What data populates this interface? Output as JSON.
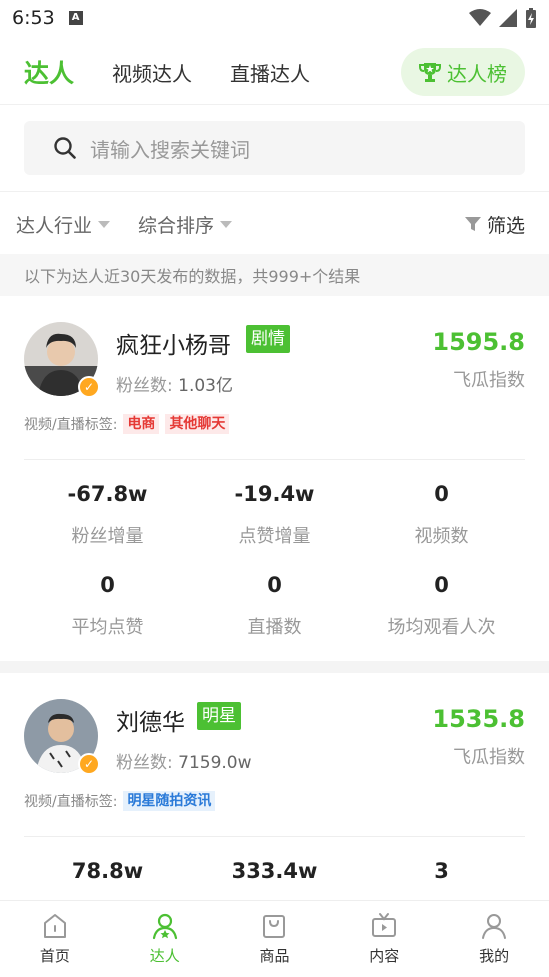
{
  "status": {
    "time": "6:53",
    "notif_letter": "A"
  },
  "tabs": [
    {
      "label": "达人"
    },
    {
      "label": "视频达人"
    },
    {
      "label": "直播达人"
    }
  ],
  "rank_button": {
    "label": "达人榜",
    "icon": "trophy-icon"
  },
  "search": {
    "placeholder": "请输入搜索关键词",
    "icon": "search-icon"
  },
  "filters": {
    "industry": "达人行业",
    "sort": "综合排序",
    "screen": "筛选"
  },
  "notice": "以下为达人近30天发布的数据，共999+个结果",
  "influencers": [
    {
      "name": "疯狂小杨哥",
      "category": "剧情",
      "fans_label": "粉丝数:",
      "fans_value": "1.03亿",
      "score": "1595.8",
      "score_label": "飞瓜指数",
      "tags_label": "视频/直播标签:",
      "tags": [
        "电商",
        "其他聊天"
      ],
      "stats": [
        {
          "value": "-67.8w",
          "label": "粉丝增量"
        },
        {
          "value": "-19.4w",
          "label": "点赞增量"
        },
        {
          "value": "0",
          "label": "视频数"
        },
        {
          "value": "0",
          "label": "平均点赞"
        },
        {
          "value": "0",
          "label": "直播数"
        },
        {
          "value": "0",
          "label": "场均观看人次"
        }
      ]
    },
    {
      "name": "刘德华",
      "category": "明星",
      "fans_label": "粉丝数:",
      "fans_value": "7159.0w",
      "score": "1535.8",
      "score_label": "飞瓜指数",
      "tags_label": "视频/直播标签:",
      "tags": [
        "明星随拍资讯"
      ],
      "stats": [
        {
          "value": "78.8w"
        },
        {
          "value": "333.4w"
        },
        {
          "value": "3"
        }
      ]
    }
  ],
  "bottom_nav": [
    {
      "label": "首页",
      "icon": "home-icon"
    },
    {
      "label": "达人",
      "icon": "influencer-icon"
    },
    {
      "label": "商品",
      "icon": "bag-icon"
    },
    {
      "label": "内容",
      "icon": "tv-icon"
    },
    {
      "label": "我的",
      "icon": "user-icon"
    }
  ],
  "colors": {
    "accent": "#4cc033",
    "verify": "#ffa820",
    "tag_red": "#e53935",
    "tag_blue": "#2a7ad8"
  }
}
